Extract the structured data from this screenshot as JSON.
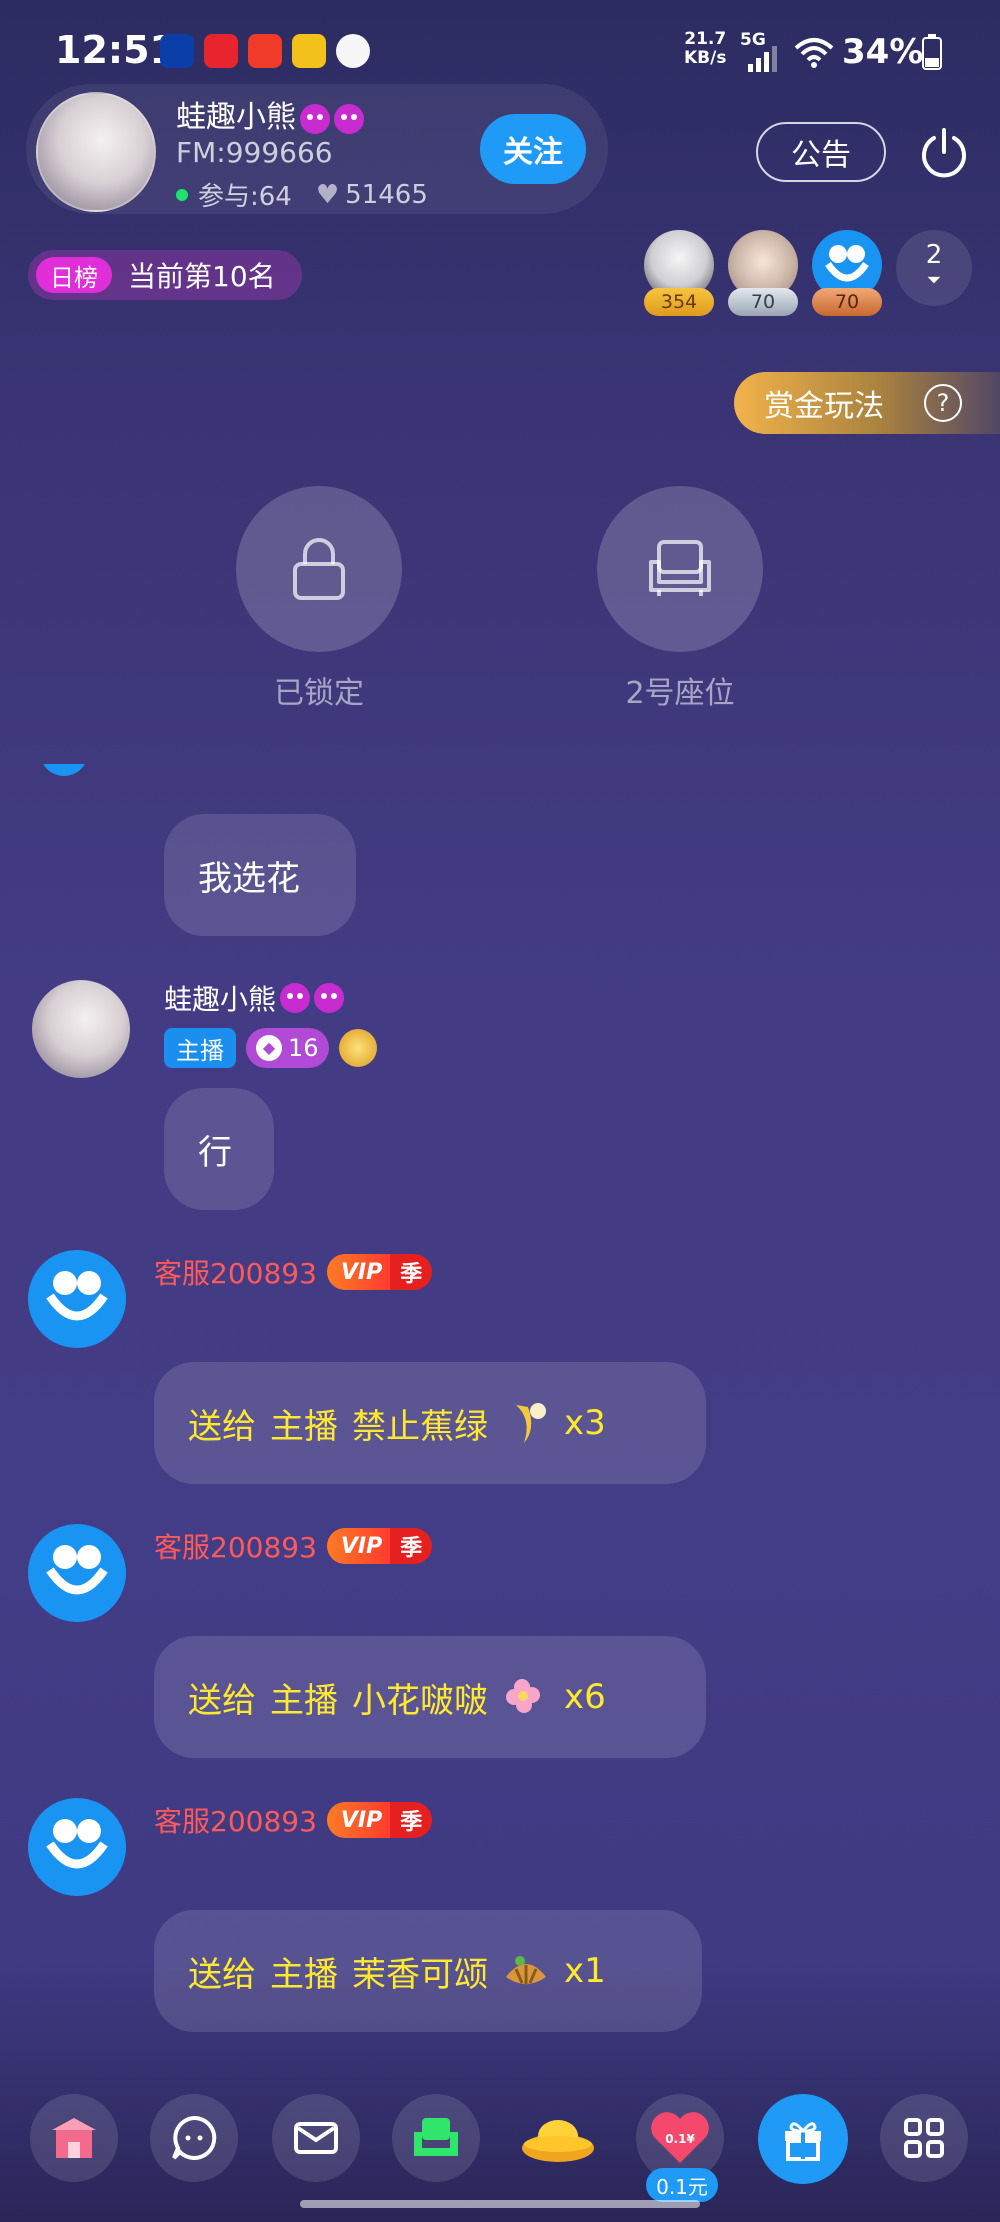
{
  "status_bar": {
    "time": "12:51",
    "net_speed_value": "21.7",
    "net_speed_unit": "KB/s",
    "network": "5G",
    "battery": "34%"
  },
  "host": {
    "name": "蛙趣小熊",
    "fm_id": "FM:999666",
    "participants": "参与:64",
    "likes": "51465",
    "follow_label": "关注"
  },
  "header": {
    "notice_label": "公告"
  },
  "ranking": {
    "tag": "日榜",
    "text": "当前第10名"
  },
  "audience": [
    {
      "badge": "354"
    },
    {
      "badge": "70"
    },
    {
      "badge": "70"
    }
  ],
  "audience_more": "2",
  "bounty": {
    "label": "赏金玩法",
    "help": "?"
  },
  "seats": [
    {
      "label": "已锁定",
      "icon": "lock-icon"
    },
    {
      "label": "2号座位",
      "icon": "sofa-icon"
    }
  ],
  "chat": {
    "msg1_text": "我选花",
    "msg2_user": "蛙趣小熊",
    "msg2_role": "主播",
    "msg2_level": "16",
    "msg2_text": "行",
    "cs_user": "客服200893",
    "vip_label": "VIP",
    "vip_season": "季",
    "gifts": [
      {
        "send": "送给",
        "target": "主播",
        "gift": "禁止蕉绿",
        "count": "x3"
      },
      {
        "send": "送给",
        "target": "主播",
        "gift": "小花啵啵",
        "count": "x6"
      },
      {
        "send": "送给",
        "target": "主播",
        "gift": "茉香可颂",
        "count": "x1"
      }
    ]
  },
  "bottom_bar": {
    "heart_gift_price": "0.1元",
    "heart_gift_tag": "0.1¥"
  },
  "colors": {
    "accent_blue": "#1f9bf7",
    "gift_text": "#ffe930",
    "cs_name": "#ff5a5a"
  }
}
